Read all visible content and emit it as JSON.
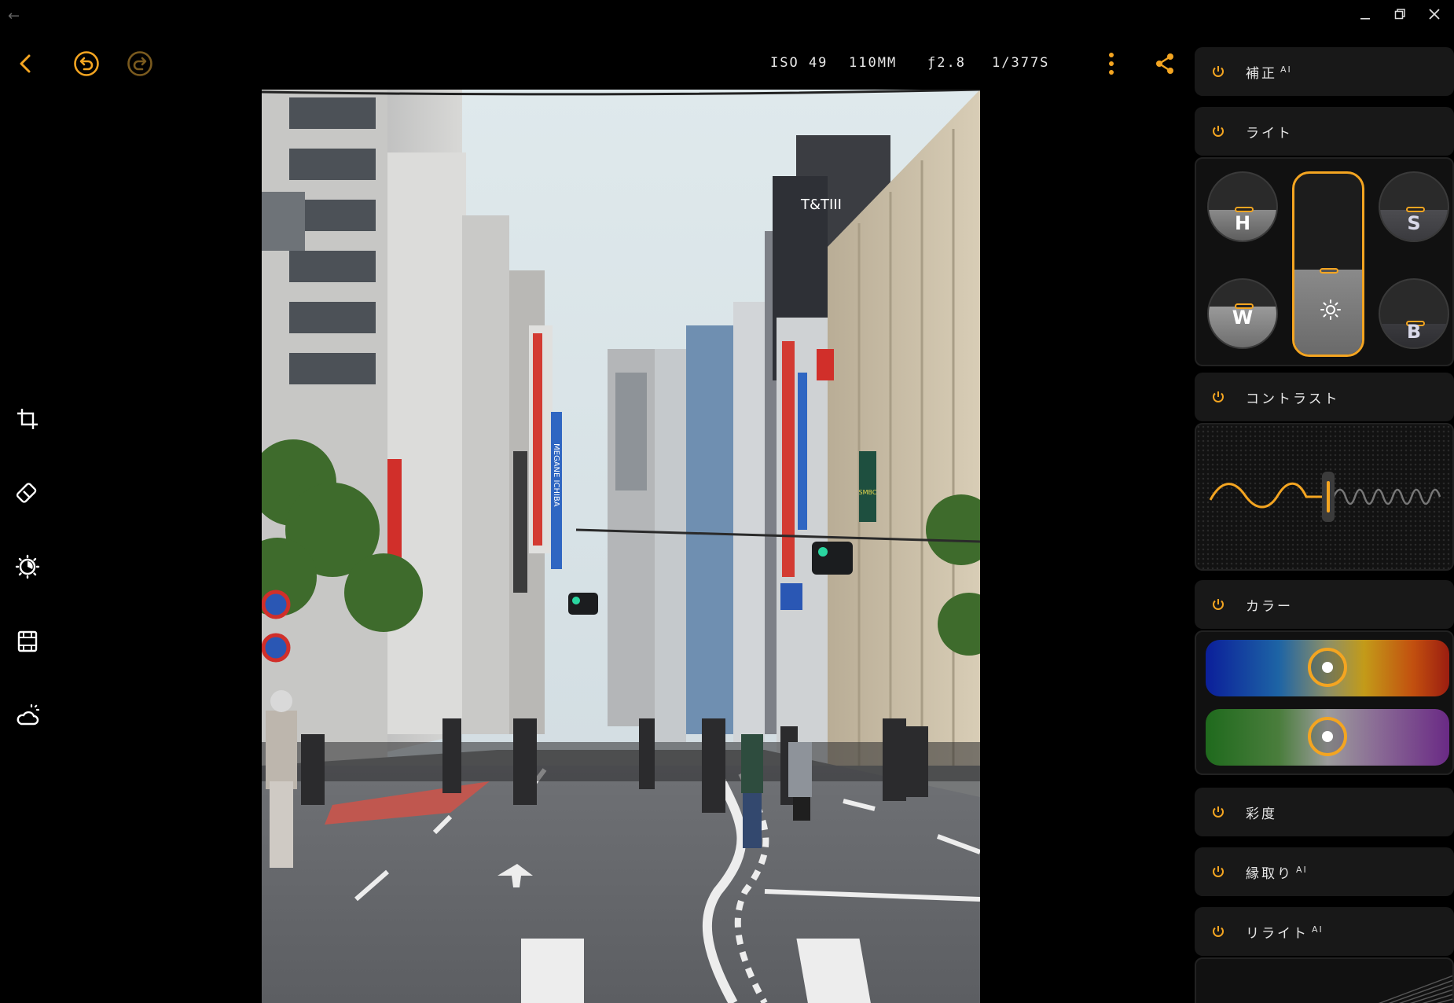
{
  "window": {
    "back_icon": "arrow-left-icon",
    "minimize_icon": "minimize-icon",
    "restore_icon": "restore-icon",
    "close_icon": "close-icon"
  },
  "toolbar": {
    "back_icon": "chevron-left-icon",
    "undo_icon": "undo-icon",
    "redo_icon": "redo-icon",
    "more_icon": "more-vertical-icon",
    "share_icon": "share-icon",
    "exif": {
      "iso": "ISO 49",
      "focal_length": "110MM",
      "aperture": "ƒ2.8",
      "shutter": "1/377S"
    }
  },
  "tools": [
    {
      "name": "crop",
      "icon": "crop-icon"
    },
    {
      "name": "eraser",
      "icon": "eraser-icon"
    },
    {
      "name": "adjust",
      "icon": "aperture-icon"
    },
    {
      "name": "film",
      "icon": "film-icon"
    },
    {
      "name": "weather",
      "icon": "weather-icon"
    }
  ],
  "photo": {
    "signs": {
      "building": "T&TIII",
      "bank": "SMBC",
      "store": "MEGANE ICHIBA"
    }
  },
  "panel": {
    "sections": {
      "correction": {
        "label": "補正",
        "ai": "AI"
      },
      "light": {
        "label": "ライト"
      },
      "contrast": {
        "label": "コントラスト"
      },
      "color": {
        "label": "カラー"
      },
      "saturation": {
        "label": "彩度"
      },
      "edging": {
        "label": "縁取り",
        "ai": "AI"
      },
      "relight": {
        "label": "リライト",
        "ai": "AI"
      }
    },
    "light_knobs": {
      "h": {
        "label": "H",
        "level": 0.45
      },
      "s": {
        "label": "S",
        "level": 0.45
      },
      "w": {
        "label": "W",
        "level": 0.6
      },
      "b": {
        "label": "B",
        "level": 0.35
      },
      "exposure_level": 0.47
    },
    "color_sliders": {
      "temperature": {
        "value": 0.5
      },
      "tint": {
        "value": 0.5
      }
    },
    "accent_color": "#f4a521"
  }
}
